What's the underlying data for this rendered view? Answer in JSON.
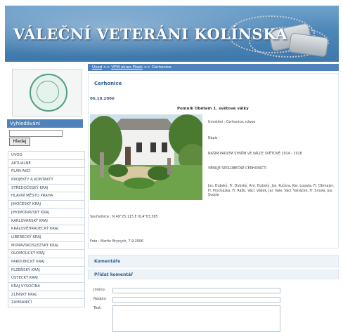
{
  "header": {
    "banner_title": "VÁLEČNÍ VETERÁNI KOLÍNSKA"
  },
  "search": {
    "title": "Vyhledávání",
    "button_label": "Hledej"
  },
  "sidebar": {
    "items": [
      {
        "label": "ÚVOD"
      },
      {
        "label": "AKTUÁLNĚ"
      },
      {
        "label": "PLÁN AKCÍ"
      },
      {
        "label": "PROJEKTY A KONTAKTY"
      },
      {
        "label": "STŘEDOČESKÝ KRAJ"
      },
      {
        "label": "HLAVNÍ MĚSTO PRAHA"
      },
      {
        "label": "JIHOČESKÝ KRAJ"
      },
      {
        "label": "JIHOMORAVSKÝ KRAJ"
      },
      {
        "label": "KARLOVARSKÝ KRAJ"
      },
      {
        "label": "KRÁLOVÉHRADECKÝ KRAJ"
      },
      {
        "label": "LIBERECKÝ KRAJ"
      },
      {
        "label": "MORAVSKOSLEZSKÝ KRAJ"
      },
      {
        "label": "OLOMOUCKÝ KRAJ"
      },
      {
        "label": "PARDUBICKÝ KRAJ"
      },
      {
        "label": "PLZEŇSKÝ KRAJ"
      },
      {
        "label": "ÚSTECKÝ KRAJ"
      },
      {
        "label": "KRAJ VYSOČINA"
      },
      {
        "label": "ZLÍNSKÝ KRAJ"
      },
      {
        "label": "ZAHRANIČÍ"
      }
    ]
  },
  "breadcrumb": {
    "home": "Úvod",
    "sep1": ">>",
    "district": "VPM okres Písek",
    "sep2": ">>",
    "current": "Cerhonice"
  },
  "article": {
    "place": "Cerhonice",
    "date": "06.10.2006",
    "monument_title": "Pomník Obětem 1. světové války",
    "location": "Umístění : Cerhonice, náves",
    "inscription_label": "Nápis :",
    "line1": "NAŠIM PADLÝM SYNŮM VE VÁLCE SVĚTOVÉ 1914 - 1918",
    "line2": "VĚNUJE SPOLOBEČNÉ CERHONIČTÍ",
    "names": "Jos. Dubský, Fr. Dubský, Ant. Dubský, Jos. Kučera, Kar. Lopata, Fr. Obrnajer, Fr. Procházka, Fr. Rážb, Václ. Vášek, Jar. Vale, Václ. Vanáček, Fr. Smola, Jos. Svojše",
    "coords": "Souřadnice : N 49°25,115 E 014°03,365",
    "photo": "Foto : Martin Brynych, 7.9.2006"
  },
  "comments": {
    "title": "Komentáře",
    "add_title": "Přidat komentář",
    "name_label": "Jméno:",
    "subject_label": "Nadpis:",
    "text_label": "Text:"
  }
}
